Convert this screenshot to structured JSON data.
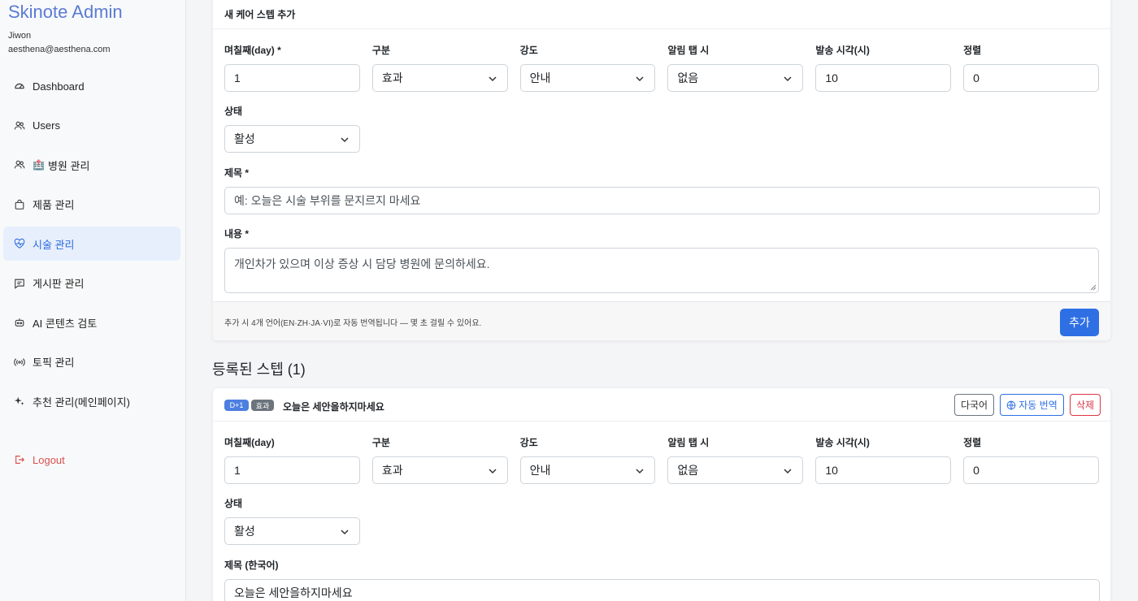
{
  "sidebar": {
    "brand": "Skinote Admin",
    "user_name": "Jiwon",
    "user_email": "aesthena@aesthena.com",
    "items": [
      {
        "label": "Dashboard",
        "icon": "dashboard-gauge-icon"
      },
      {
        "label": "Users",
        "icon": "users-icon"
      },
      {
        "label": "병원 관리",
        "icon": "users-icon",
        "emoji": "🏥"
      },
      {
        "label": "제품 관리",
        "icon": "shopping-bag-icon"
      },
      {
        "label": "시술 관리",
        "icon": "heart-pulse-icon",
        "active": true
      },
      {
        "label": "게시판 관리",
        "icon": "message-square-icon"
      },
      {
        "label": "AI 콘텐츠 검토",
        "icon": "robot-icon"
      },
      {
        "label": "토픽 관리",
        "icon": "broadcast-icon"
      },
      {
        "label": "추천 관리(메인페이지)",
        "icon": "sparkles-icon"
      }
    ],
    "logout": "Logout"
  },
  "new_step": {
    "header": "새 케어 스텝 추가",
    "fields": [
      {
        "label": "며칠째(day) *",
        "value": "1"
      },
      {
        "label": "구분",
        "value": "효과"
      },
      {
        "label": "강도",
        "value": "안내"
      },
      {
        "label": "알림 탭 시",
        "value": "없음"
      },
      {
        "label": "발송 시각(시)",
        "value": "10"
      },
      {
        "label": "정렬",
        "value": "0"
      }
    ],
    "status": {
      "label": "상태",
      "value": "활성"
    },
    "title": {
      "label": "제목 *",
      "placeholder": "예: 오늘은 시술 부위를 문지르지 마세요"
    },
    "content": {
      "label": "내용 *",
      "value": "개인차가 있으며 이상 증상 시 담당 병원에 문의하세요."
    },
    "footer_note": "추가 시 4개 언어(EN·ZH·JA·VI)로 자동 번역됩니다 — 몇 초 걸릴 수 있어요.",
    "add_button": "추가"
  },
  "registered": {
    "title": "등록된 스텝 (1)",
    "steps": [
      {
        "day_badge": "D+1",
        "type_badge": "효과",
        "title": "오늘은 세안을하지마세요",
        "btn_multilang": "다국어",
        "btn_translate": "자동 번역",
        "btn_delete": "삭제",
        "fields": [
          {
            "label": "며칠째(day)",
            "value": "1"
          },
          {
            "label": "구분",
            "value": "효과"
          },
          {
            "label": "강도",
            "value": "안내"
          },
          {
            "label": "알림 탭 시",
            "value": "없음"
          },
          {
            "label": "발송 시각(시)",
            "value": "10"
          },
          {
            "label": "정렬",
            "value": "0"
          }
        ],
        "status": {
          "label": "상태",
          "value": "활성"
        },
        "title_field": {
          "label": "제목 (한국어)",
          "value": "오늘은 세안을하지마세요"
        }
      }
    ]
  }
}
